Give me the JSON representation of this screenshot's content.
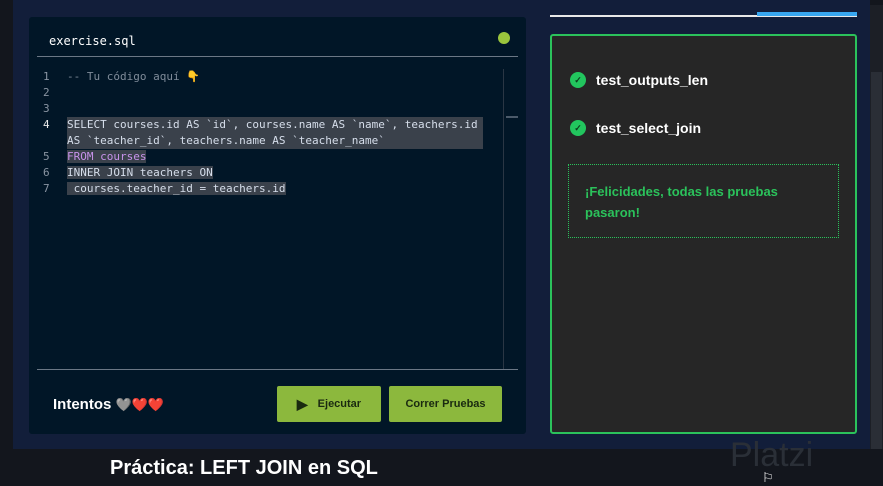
{
  "editor": {
    "filename": "exercise.sql",
    "lines": [
      {
        "n": "1",
        "text": "-- Tu código aquí 👇"
      },
      {
        "n": "2",
        "text": ""
      },
      {
        "n": "3",
        "text": ""
      },
      {
        "n": "4",
        "text": "SELECT courses.id AS `id`, courses.name AS `name`, teachers.id AS `teacher_id`, teachers.name AS `teacher_name`"
      },
      {
        "n": "5",
        "text": "FROM courses"
      },
      {
        "n": "6",
        "text": "INNER JOIN teachers ON"
      },
      {
        "n": "7",
        "text": " courses.teacher_id = teachers.id"
      }
    ],
    "attempts_label": "Intentos",
    "hearts": "🩶❤️❤️",
    "run_label": "Ejecutar",
    "test_label": "Correr Pruebas"
  },
  "results": {
    "tests": [
      {
        "name": "test_outputs_len",
        "status": "passed"
      },
      {
        "name": "test_select_join",
        "status": "passed"
      }
    ],
    "message": "¡Felicidades, todas las pruebas pasaron!"
  },
  "page_title": "Práctica: LEFT JOIN en SQL",
  "watermark": "Platzi",
  "colors": {
    "accent": "#8cb83d",
    "success": "#2bc25b",
    "editor_bg": "#011627"
  }
}
